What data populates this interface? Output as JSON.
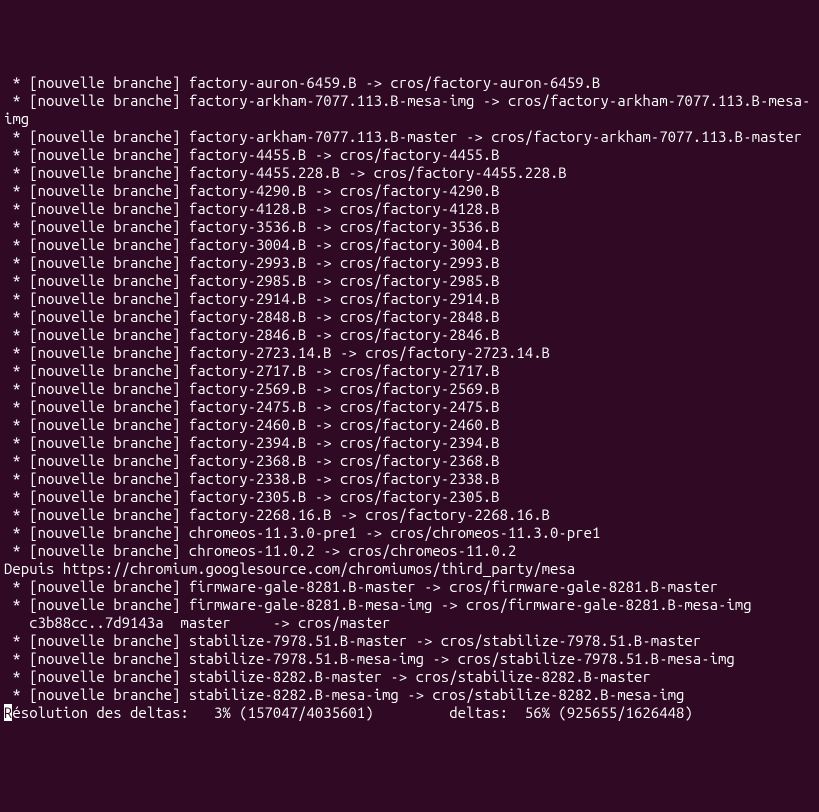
{
  "branch_label": "[nouvelle branche]",
  "lines": [
    {
      "src": "factory-auron-6459.B",
      "dst": "cros/factory-auron-6459.B"
    },
    {
      "src": "factory-arkham-7077.113.B-mesa-img",
      "dst": "cros/factory-arkham-7077.113.B-mesa-img"
    },
    {
      "src": "factory-arkham-7077.113.B-master",
      "dst": "cros/factory-arkham-7077.113.B-master"
    },
    {
      "src": "factory-4455.B",
      "dst": "cros/factory-4455.B"
    },
    {
      "src": "factory-4455.228.B",
      "dst": "cros/factory-4455.228.B"
    },
    {
      "src": "factory-4290.B",
      "dst": "cros/factory-4290.B"
    },
    {
      "src": "factory-4128.B",
      "dst": "cros/factory-4128.B"
    },
    {
      "src": "factory-3536.B",
      "dst": "cros/factory-3536.B"
    },
    {
      "src": "factory-3004.B",
      "dst": "cros/factory-3004.B"
    },
    {
      "src": "factory-2993.B",
      "dst": "cros/factory-2993.B"
    },
    {
      "src": "factory-2985.B",
      "dst": "cros/factory-2985.B"
    },
    {
      "src": "factory-2914.B",
      "dst": "cros/factory-2914.B"
    },
    {
      "src": "factory-2848.B",
      "dst": "cros/factory-2848.B"
    },
    {
      "src": "factory-2846.B",
      "dst": "cros/factory-2846.B"
    },
    {
      "src": "factory-2723.14.B",
      "dst": "cros/factory-2723.14.B"
    },
    {
      "src": "factory-2717.B",
      "dst": "cros/factory-2717.B"
    },
    {
      "src": "factory-2569.B",
      "dst": "cros/factory-2569.B"
    },
    {
      "src": "factory-2475.B",
      "dst": "cros/factory-2475.B"
    },
    {
      "src": "factory-2460.B",
      "dst": "cros/factory-2460.B"
    },
    {
      "src": "factory-2394.B",
      "dst": "cros/factory-2394.B"
    },
    {
      "src": "factory-2368.B",
      "dst": "cros/factory-2368.B"
    },
    {
      "src": "factory-2338.B",
      "dst": "cros/factory-2338.B"
    },
    {
      "src": "factory-2305.B",
      "dst": "cros/factory-2305.B"
    },
    {
      "src": "factory-2268.16.B",
      "dst": "cros/factory-2268.16.B"
    },
    {
      "src": "chromeos-11.3.0-pre1",
      "dst": "cros/chromeos-11.3.0-pre1"
    },
    {
      "src": "chromeos-11.0.2",
      "dst": "cros/chromeos-11.0.2"
    }
  ],
  "depuis": "Depuis https://chromium.googlesource.com/chromiumos/third_party/mesa",
  "post_lines": [
    {
      "src": "firmware-gale-8281.B-master",
      "dst": "cros/firmware-gale-8281.B-master"
    },
    {
      "src": "firmware-gale-8281.B-mesa-img",
      "dst": "cros/firmware-gale-8281.B-mesa-img"
    }
  ],
  "update_line": "   c3b88cc..7d9143a  master     -> cros/master",
  "post_lines2": [
    {
      "src": "stabilize-7978.51.B-master",
      "dst": "cros/stabilize-7978.51.B-master"
    },
    {
      "src": "stabilize-7978.51.B-mesa-img",
      "dst": "cros/stabilize-7978.51.B-mesa-img"
    },
    {
      "src": "stabilize-8282.B-master",
      "dst": "cros/stabilize-8282.B-master"
    },
    {
      "src": "stabilize-8282.B-mesa-img",
      "dst": "cros/stabilize-8282.B-mesa-img"
    }
  ],
  "status": {
    "cursor_char": "R",
    "rest": "ésolution des deltas:   3% (157047/4035601)         deltas:  56% (925655/1626448)"
  }
}
